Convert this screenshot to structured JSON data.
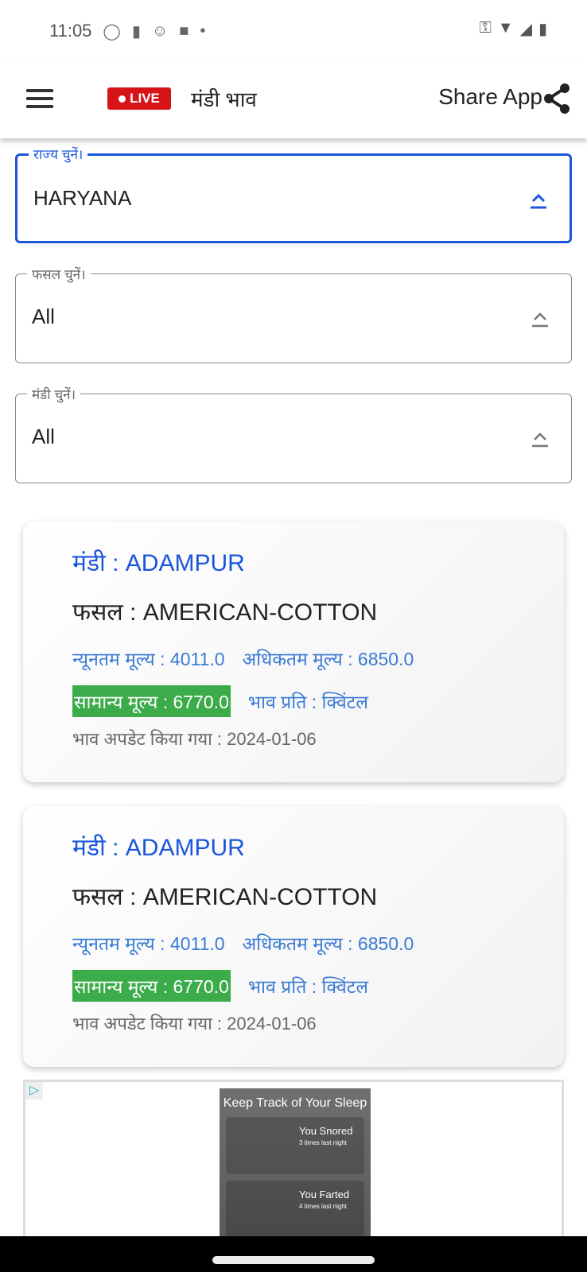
{
  "status_bar": {
    "time": "11:05",
    "left_icons": [
      "whatsapp-icon",
      "battery-saver-icon",
      "face-icon",
      "shopping-bag-icon",
      "dot-icon"
    ],
    "right_icons": [
      "vpn-key-icon",
      "wifi-icon",
      "signal-icon",
      "battery-charging-icon"
    ]
  },
  "app_bar": {
    "live_badge": "LIVE",
    "title": "मंडी भाव",
    "share_label": "Share App"
  },
  "filters": [
    {
      "label": "राज्य चुनें।",
      "value": "HARYANA",
      "active": true
    },
    {
      "label": "फसल चुनें।",
      "value": "All",
      "active": false
    },
    {
      "label": "मंडी चुनें।",
      "value": "All",
      "active": false
    }
  ],
  "cards": [
    {
      "mandi": "मंडी : ADAMPUR",
      "crop": "फसल : AMERICAN-COTTON",
      "min_price": "न्यूनतम मूल्य : 4011.0",
      "max_price": "अधिकतम मूल्य : 6850.0",
      "modal_price": "सामान्य मूल्य : 6770.0",
      "unit": "भाव प्रति : क्विंटल",
      "updated": "भाव अपडेट किया गया : 2024-01-06"
    },
    {
      "mandi": "मंडी : ADAMPUR",
      "crop": "फसल : AMERICAN-COTTON",
      "min_price": "न्यूनतम मूल्य : 4011.0",
      "max_price": "अधिकतम मूल्य : 6850.0",
      "modal_price": "सामान्य मूल्य : 6770.0",
      "unit": "भाव प्रति : क्विंटल",
      "updated": "भाव अपडेट किया गया : 2024-01-06"
    }
  ],
  "ad": {
    "headline": "Keep Track of Your Sleep",
    "items": [
      {
        "title": "You Snored",
        "sub": "3 times last night"
      },
      {
        "title": "You Farted",
        "sub": "4 times last night"
      }
    ]
  },
  "colors": {
    "accent": "#1a56db",
    "live": "#d61418",
    "modal_price_bg": "#3cab4a",
    "price_text": "#3a7bd5"
  }
}
